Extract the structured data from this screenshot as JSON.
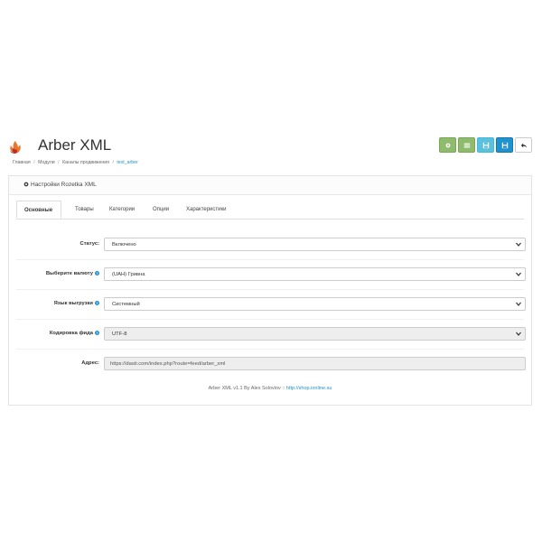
{
  "header": {
    "title": "Arber XML",
    "logo_icon": "arber-flame-logo",
    "breadcrumb": [
      "Главная",
      "Модули",
      "Каналы продвижения",
      "text_arber"
    ]
  },
  "toolbar": {
    "buttons": [
      {
        "name": "settings-button",
        "icon": "gear-icon",
        "color": "#8fbb6c"
      },
      {
        "name": "list-button",
        "icon": "list-icon",
        "color": "#8fbb6c"
      },
      {
        "name": "save-copy-button",
        "icon": "save-icon",
        "color": "#5bc0de"
      },
      {
        "name": "save-button",
        "icon": "save-icon",
        "color": "#1e91cf"
      },
      {
        "name": "back-button",
        "icon": "reply-icon",
        "color": "#ffffff"
      }
    ]
  },
  "panel": {
    "heading": "Настройки Rozetka XML",
    "tabs": [
      "Основные",
      "Товары",
      "Категории",
      "Опции",
      "Характеристики"
    ],
    "active_tab": "Основные",
    "fields": {
      "status": {
        "label": "Статус:",
        "value": "Включено"
      },
      "currency": {
        "label": "Выберите валюту",
        "value": "(UAH) Гривна"
      },
      "language": {
        "label": "Язык выгрузки",
        "value": "Системный"
      },
      "encoding": {
        "label": "Кодировка фида",
        "value": "UTF-8"
      },
      "address": {
        "label": "Адрес:",
        "value": "https://dasti.com/index.php?route=feed/arber_xml"
      }
    },
    "footer": {
      "text": "Arber XML v1.1 By Alex Soloviov ::",
      "link": "http://shop.ionline.su"
    }
  }
}
